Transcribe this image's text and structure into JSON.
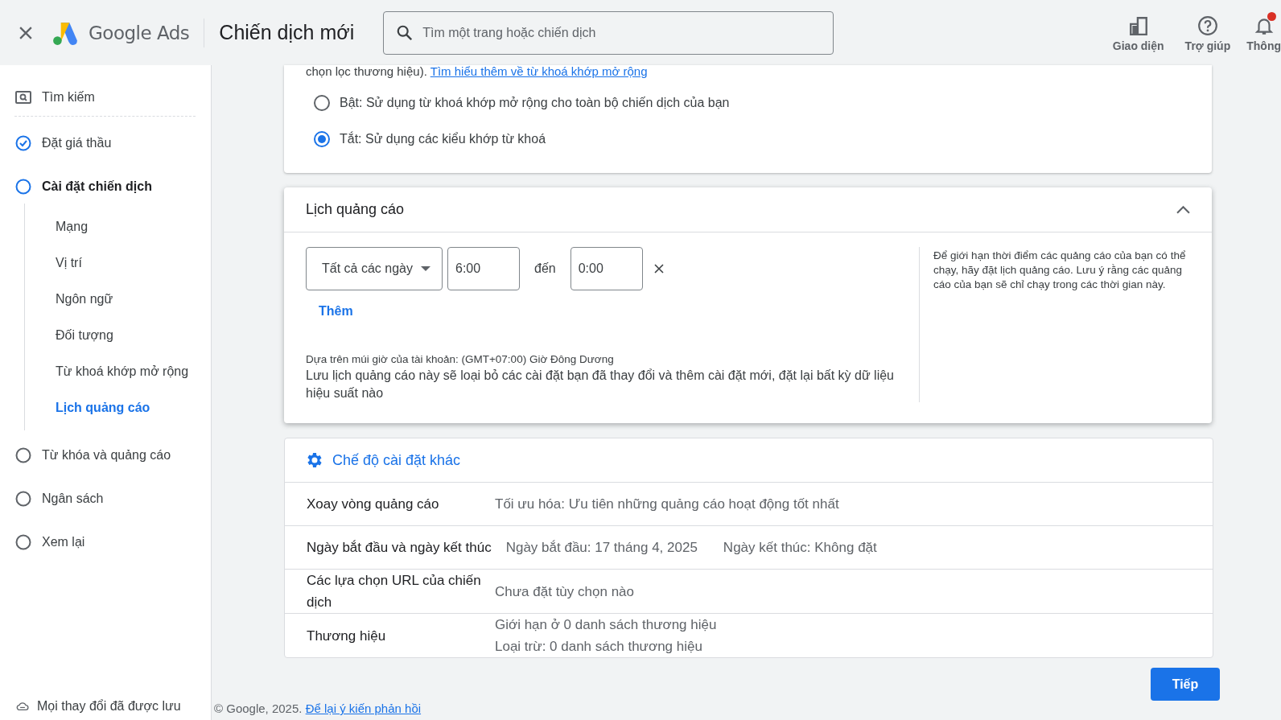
{
  "header": {
    "logo": "Google Ads",
    "title": "Chiến dịch mới",
    "search": {
      "placeholder": "Tìm một trang hoặc chiến dịch"
    },
    "actions": [
      {
        "kind": "appearance",
        "label": "Giao diện",
        "alert": false
      },
      {
        "kind": "help",
        "label": "Trợ giúp",
        "alert": false
      },
      {
        "kind": "notifications",
        "label": "Thông",
        "alert": true
      }
    ]
  },
  "sidebar": {
    "steps": [
      {
        "label": "Tìm kiếm",
        "kind": "search"
      },
      {
        "label": "Đặt giá thầu",
        "kind": "step",
        "done": true,
        "selected": false
      },
      {
        "label": "Cài đặt chiến dịch",
        "kind": "step",
        "done": false,
        "selected": true,
        "children": [
          {
            "label": "Mạng",
            "selected": false
          },
          {
            "label": "Vị trí",
            "selected": false
          },
          {
            "label": "Ngôn ngữ",
            "selected": false
          },
          {
            "label": "Đối tượng",
            "selected": false
          },
          {
            "label": "Từ khoá khớp mở rộng",
            "selected": false
          },
          {
            "label": "Lịch quảng cáo",
            "selected": true
          }
        ]
      },
      {
        "label": "Từ khóa và quảng cáo",
        "kind": "step",
        "done": false,
        "selected": false
      },
      {
        "label": "Ngân sách",
        "kind": "step",
        "done": false,
        "selected": false
      },
      {
        "label": "Xem lại",
        "kind": "step",
        "done": false,
        "selected": false
      }
    ],
    "saved": "Mọi thay đổi đã được lưu"
  },
  "broad_match": {
    "intro": "chọn lọc thương hiệu).",
    "link": "Tìm hiểu thêm về từ khoá khớp mở rộng",
    "options": [
      {
        "label": "Bật: Sử dụng từ khoá khớp mở rộng cho toàn bộ chiến dịch của bạn",
        "selected": false
      },
      {
        "label": "Tắt: Sử dụng các kiểu khớp từ khoá",
        "selected": true
      }
    ]
  },
  "schedule": {
    "title": "Lịch quảng cáo",
    "expanded": true,
    "day": "Tất cả các ngày",
    "start": "6:00",
    "between": "đến",
    "end": "0:00",
    "add": "Thêm",
    "timezone": "Dựa trên múi giờ của tài khoản: (GMT+07:00) Giờ Đông Dương",
    "warning": "Lưu lịch quảng cáo này sẽ loại bỏ các cài đặt bạn đã thay đổi và thêm cài đặt mới, đặt lại bất kỳ dữ liệu hiệu suất nào",
    "help": "Để giới hạn thời điểm các quảng cáo của bạn có thể chạy, hãy đặt lịch quảng cáo. Lưu ý rằng các quảng cáo của bạn sẽ chỉ chạy trong các thời gian này."
  },
  "other_settings": {
    "title": "Chế độ cài đặt khác",
    "rows": [
      {
        "kind": "stacked",
        "label": "Xoay vòng quảng cáo",
        "values": [
          "Tối ưu hóa: Ưu tiên những quảng cáo hoạt động tốt nhất"
        ]
      },
      {
        "kind": "inline",
        "label": "Ngày bắt đầu và ngày kết thúc",
        "values": [
          "Ngày bắt đầu: 17 tháng 4, 2025",
          "Ngày kết thúc: Không đặt"
        ]
      },
      {
        "kind": "stacked",
        "label": "Các lựa chọn URL của chiến dịch",
        "values": [
          "Chưa đặt tùy chọn nào"
        ]
      },
      {
        "kind": "stacked",
        "label": "Thương hiệu",
        "values": [
          "Giới hạn ở 0 danh sách thương hiệu",
          "Loại trừ: 0 danh sách thương hiệu"
        ]
      }
    ]
  },
  "next": "Tiếp",
  "footer": {
    "copyright": "© Google, 2025.",
    "link": "Để lại ý kiến phản hồi"
  }
}
